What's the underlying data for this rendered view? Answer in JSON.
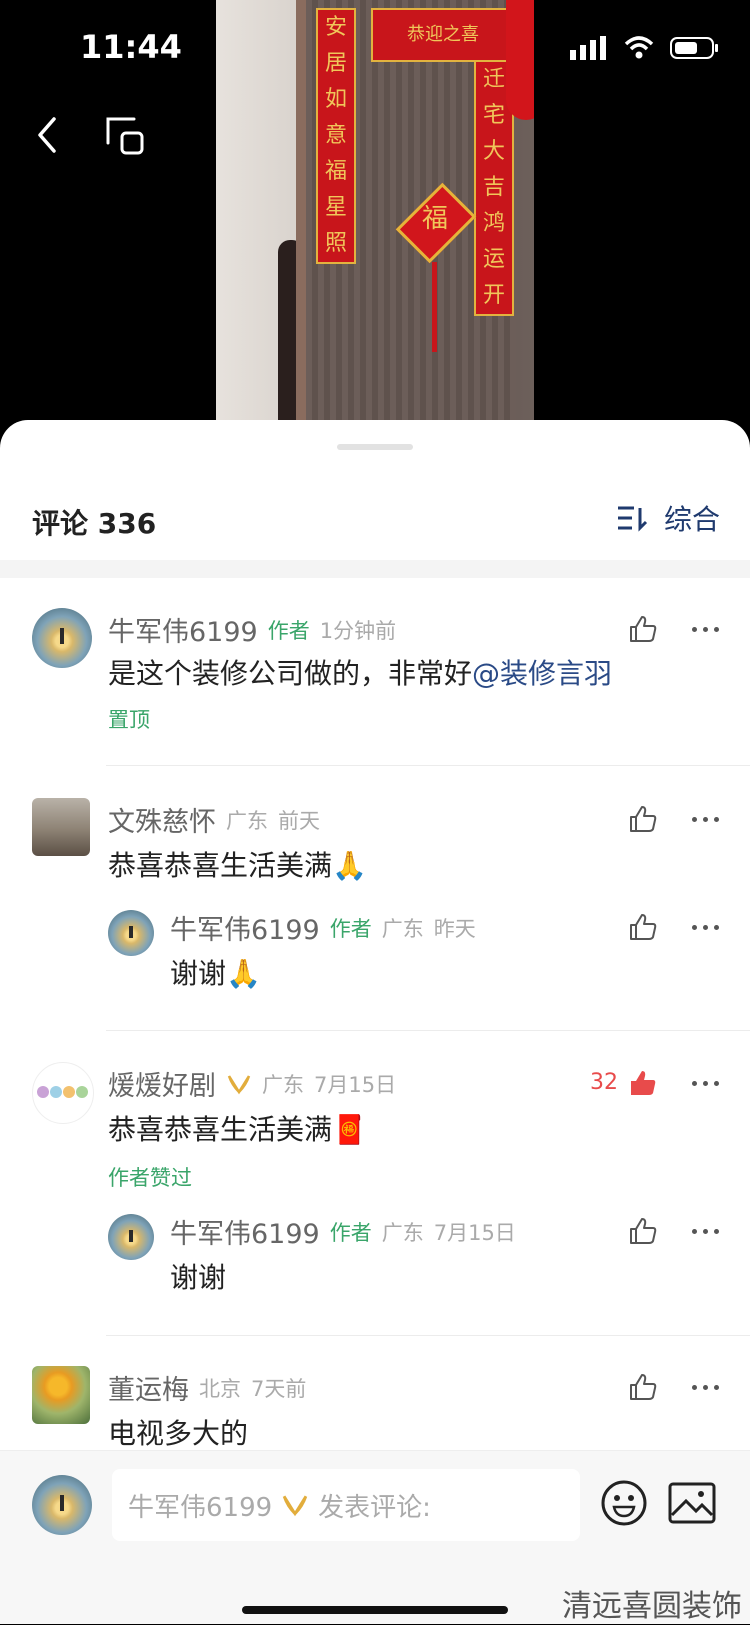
{
  "status": {
    "time": "11:44"
  },
  "video_frame": {
    "banner": "恭迎之喜",
    "left_couplet": [
      "安",
      "居",
      "如",
      "意",
      "福",
      "星",
      "照"
    ],
    "right_couplet": [
      "迁",
      "宅",
      "大",
      "吉",
      "鸿",
      "运",
      "开"
    ],
    "fu": "福"
  },
  "comments_header": {
    "title": "评论 336",
    "sort_label": "综合"
  },
  "comments": [
    {
      "name": "牛军伟6199",
      "author_tag": "作者",
      "time": "1分钟前",
      "text_main": "是这个装修公司做的，非常好",
      "mention": "@装修言羽",
      "tag": "置顶"
    },
    {
      "name": "文殊慈怀",
      "region": "广东",
      "time": "前天",
      "text": "恭喜恭喜生活美满🙏",
      "reply": {
        "name": "牛军伟6199",
        "author_tag": "作者",
        "region": "广东",
        "time": "昨天",
        "text": "谢谢🙏"
      }
    },
    {
      "name": "煖煖好剧",
      "region": "广东",
      "time": "7月15日",
      "likes": "32",
      "text": "恭喜恭喜生活美满🧧",
      "tag": "作者赞过",
      "reply": {
        "name": "牛军伟6199",
        "author_tag": "作者",
        "region": "广东",
        "time": "7月15日",
        "text": "谢谢"
      }
    },
    {
      "name": "董运梅",
      "region": "北京",
      "time": "7天前",
      "text": "电视多大的"
    }
  ],
  "composer": {
    "user": "牛军伟6199",
    "placeholder": "发表评论:"
  },
  "watermark": "清远喜圆装饰",
  "colors": {
    "author_green": "#3aa56a",
    "mention_blue": "#2a4a86",
    "like_red": "#e84b4b"
  },
  "icons": [
    "back-arrow-icon",
    "screen-cast-icon",
    "signal-icon",
    "wifi-icon",
    "battery-icon",
    "sort-icon",
    "thumb-up-icon",
    "more-dots-icon",
    "emoji-icon",
    "image-icon"
  ]
}
